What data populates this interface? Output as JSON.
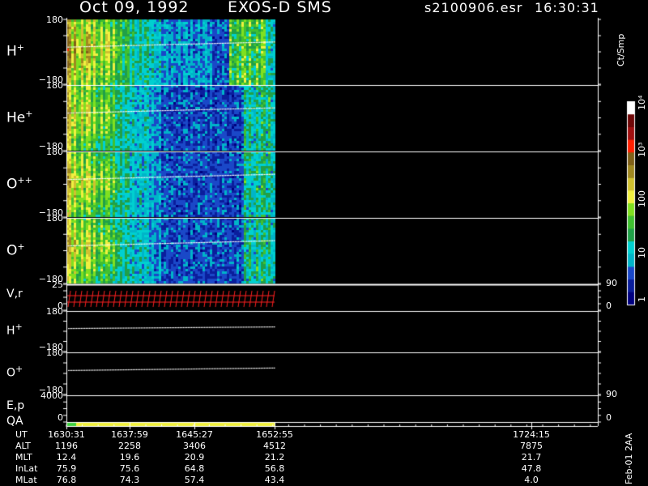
{
  "header": {
    "date": "Oct 09, 1992",
    "instrument": "EXOS-D SMS",
    "file": "s2100906.esr",
    "time": "16:30:31"
  },
  "colors": {
    "background": "#000000",
    "axis": "#ffffff",
    "trace": "#ffffff",
    "velocity_ticks": "#ff2020",
    "qa_good": "#f0f040",
    "qa_start": "#40d040"
  },
  "colorbar": {
    "units": "Ct/Smp",
    "labels": [
      "1",
      "10",
      "100",
      "10³",
      "10⁴"
    ],
    "colors": [
      "#000080",
      "#0a1e9c",
      "#1a48c8",
      "#00b4c8",
      "#00d0d0",
      "#20a048",
      "#40c030",
      "#80e020",
      "#f0f040",
      "#d0c030",
      "#a08820",
      "#806018",
      "#ff2000",
      "#a01010",
      "#700808",
      "#ffffff"
    ]
  },
  "panels": [
    {
      "id": "h-plus-pitch",
      "species": "H",
      "charge": "+",
      "ymax": "180",
      "ymin": "−180"
    },
    {
      "id": "he-plus-pitch",
      "species": "He",
      "charge": "+",
      "ymax": "180",
      "ymin": "−180"
    },
    {
      "id": "o-plusplus-pitch",
      "species": "O",
      "charge": "++",
      "ymax": "180",
      "ymin": "−180"
    },
    {
      "id": "o-plus-pitch",
      "species": "O",
      "charge": "+",
      "ymax": "180",
      "ymin": "−180"
    },
    {
      "id": "velocity",
      "species": "V,r",
      "charge": "",
      "ymax": "25",
      "ymin": "0",
      "rmax": "90",
      "rmin": "0"
    },
    {
      "id": "h-plus-line",
      "species": "H",
      "charge": "+",
      "ymax": "180",
      "ymin": "−180"
    },
    {
      "id": "o-plus-line",
      "species": "O",
      "charge": "+",
      "ymax": "180",
      "ymin": "−180"
    },
    {
      "id": "energy",
      "species": "E,p",
      "charge": "",
      "ymax": "4000",
      "ymin": "0",
      "rmax": "90",
      "rmin": "0"
    },
    {
      "id": "qa",
      "species": "QA",
      "charge": ""
    }
  ],
  "chart_data": {
    "type": "heatmap",
    "time_axis": {
      "ticks": [
        "1630:31",
        "1637:59",
        "1645:27",
        "1652:55",
        "1724:15"
      ],
      "data_end": "1652:55"
    },
    "ephemeris": [
      {
        "label": "UT",
        "values": [
          "1630:31",
          "1637:59",
          "1645:27",
          "1652:55",
          "1724:15"
        ]
      },
      {
        "label": "ALT",
        "values": [
          "1196",
          "2258",
          "3406",
          "4512",
          "7875"
        ]
      },
      {
        "label": "MLT",
        "values": [
          "12.4",
          "19.6",
          "20.9",
          "21.2",
          "21.7"
        ]
      },
      {
        "label": "InLat",
        "values": [
          "75.9",
          "75.6",
          "64.8",
          "56.8",
          "47.8"
        ]
      },
      {
        "label": "MLat",
        "values": [
          "76.8",
          "74.3",
          "57.4",
          "43.4",
          "4.0"
        ]
      }
    ],
    "colorbar_range": [
      1,
      10000
    ],
    "colorbar_scale": "log"
  },
  "footer": {
    "date": "Feb-01 2AA"
  }
}
